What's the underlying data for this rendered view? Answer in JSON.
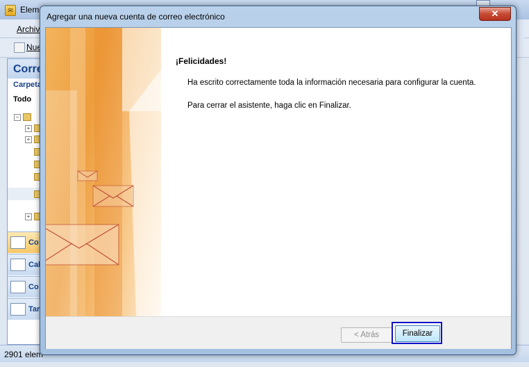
{
  "background_window": {
    "title": "Eleme",
    "menu_file_label": "Archiv",
    "toolbar_new_label": "Nue",
    "nav_header": "Corre",
    "nav_folders_label": "Carpeta",
    "nav_all_label": "Todo",
    "nav_buttons": [
      {
        "label": "Co",
        "icon": "mail-icon"
      },
      {
        "label": "Cal",
        "icon": "calendar-icon"
      },
      {
        "label": "Co",
        "icon": "contacts-icon"
      },
      {
        "label": "Tar",
        "icon": "tasks-icon"
      }
    ],
    "status_text": "2901 elem"
  },
  "dialog": {
    "title": "Agregar una nueva cuenta de correo electrónico",
    "close_glyph": "✕",
    "congrats_title": "¡Felicidades!",
    "info_text": "Ha escrito correctamente toda la información necesaria para configurar la cuenta.",
    "close_hint": "Para cerrar el asistente, haga clic en Finalizar.",
    "back_button": "< Atrás",
    "finish_button": "Finalizar"
  }
}
